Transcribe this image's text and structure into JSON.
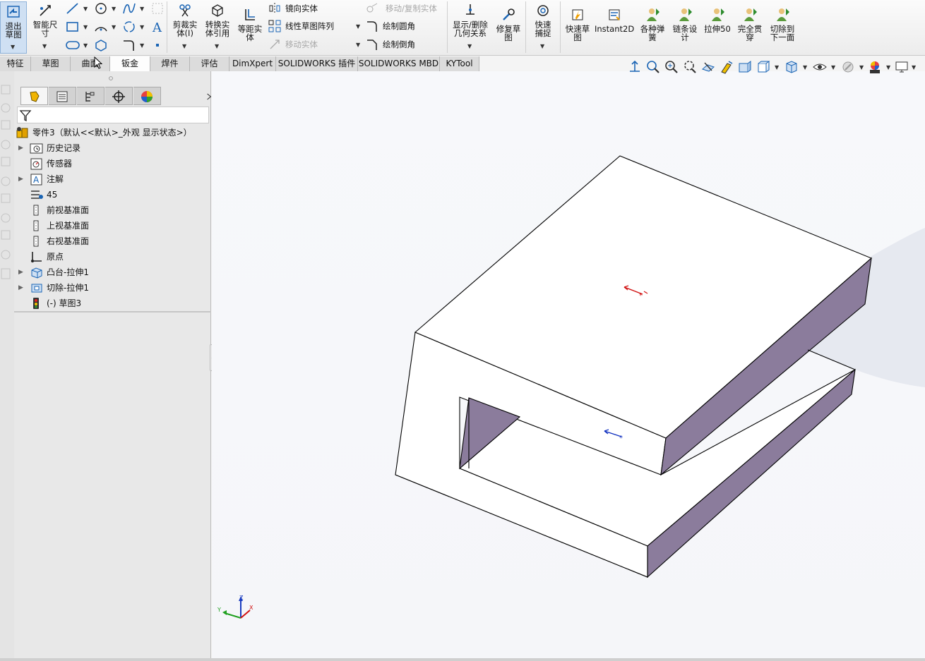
{
  "ribbon": {
    "exit_sketch": "退出草图",
    "smart_dim": "智能尺寸",
    "trim": "剪裁实体(I)",
    "convert": "转换实体引用",
    "offset": "等距实体",
    "mirror": "镜向实体",
    "linear_pattern": "线性草图阵列",
    "move": "移动实体",
    "move_copy": "移动/复制实体",
    "fillet": "绘制圆角",
    "chamfer": "绘制倒角",
    "display_relations": "显示/删除几何关系",
    "repair": "修复草图",
    "quick_snap": "快速捕捉",
    "rapid_sketch": "快速草图",
    "instant2d": "Instant2D",
    "springs": "各种弹簧",
    "chain_design": "链条设计",
    "extrude50": "拉伸50",
    "through_all": "完全贯穿",
    "cut_next": "切除到下一面"
  },
  "tabs": [
    {
      "label": "特征"
    },
    {
      "label": "草图"
    },
    {
      "label": "曲面"
    },
    {
      "label": "钣金"
    },
    {
      "label": "焊件"
    },
    {
      "label": "评估"
    },
    {
      "label": "DimXpert"
    },
    {
      "label": "SOLIDWORKS 插件"
    },
    {
      "label": "SOLIDWORKS MBD"
    },
    {
      "label": "KYTool"
    }
  ],
  "tree": {
    "root": "零件3（默认<<默认>_外观 显示状态>）",
    "items": [
      {
        "label": "历史记录",
        "icon": "history-folder-icon"
      },
      {
        "label": "传感器",
        "icon": "sensor-icon"
      },
      {
        "label": "注解",
        "icon": "annotation-icon"
      },
      {
        "label": "45",
        "icon": "material-icon"
      },
      {
        "label": "前视基准面",
        "icon": "plane-icon"
      },
      {
        "label": "上视基准面",
        "icon": "plane-icon"
      },
      {
        "label": "右视基准面",
        "icon": "plane-icon"
      },
      {
        "label": "原点",
        "icon": "origin-icon"
      },
      {
        "label": "凸台-拉伸1",
        "icon": "extrude-icon"
      },
      {
        "label": "切除-拉伸1",
        "icon": "cut-extrude-icon"
      },
      {
        "label": "(-) 草图3",
        "icon": "sketch-icon"
      }
    ]
  },
  "colors": {
    "face": "#8b7c9c",
    "accent": "#1a64b4"
  },
  "axes": {
    "x": "X",
    "y": "Y",
    "z": "Z"
  }
}
